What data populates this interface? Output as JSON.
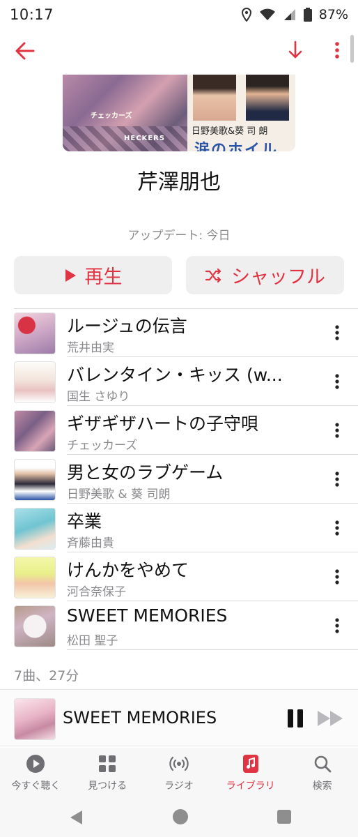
{
  "status_bar": {
    "time": "10:17",
    "battery": "87%"
  },
  "artwork": {
    "left_text": "チェッカーズ",
    "left_logo": "HECKERS",
    "right_names": "日野美歌&葵 司 朗",
    "right_title": "涙のホイル"
  },
  "playlist": {
    "title": "芹澤朋也",
    "updated": "アップデート: 今日"
  },
  "actions": {
    "play_label": "再生",
    "shuffle_label": "シャッフル"
  },
  "tracks": [
    {
      "title": "ルージュの伝言",
      "artist": "荒井由実"
    },
    {
      "title": "バレンタイン・キッス (w...",
      "artist": "国生 さゆり"
    },
    {
      "title": "ギザギザハートの子守唄",
      "artist": "チェッカーズ"
    },
    {
      "title": "男と女のラブゲーム",
      "artist": "日野美歌 & 葵 司朗"
    },
    {
      "title": "卒業",
      "artist": "斉藤由貴"
    },
    {
      "title": "けんかをやめて",
      "artist": "河合奈保子"
    },
    {
      "title": "SWEET MEMORIES",
      "artist": "松田 聖子"
    }
  ],
  "summary": "7曲、27分",
  "mini_player": {
    "title": "SWEET MEMORIES"
  },
  "tabs": [
    {
      "label": "今すぐ聴く",
      "icon": "listen-now-icon"
    },
    {
      "label": "見つける",
      "icon": "browse-grid-icon"
    },
    {
      "label": "ラジオ",
      "icon": "radio-icon"
    },
    {
      "label": "ライブラリ",
      "icon": "library-music-icon",
      "active": true
    },
    {
      "label": "検索",
      "icon": "search-icon"
    }
  ],
  "colors": {
    "accent": "#e03442",
    "secondary_text": "#8a8a8e",
    "button_bg": "#efeff0"
  }
}
